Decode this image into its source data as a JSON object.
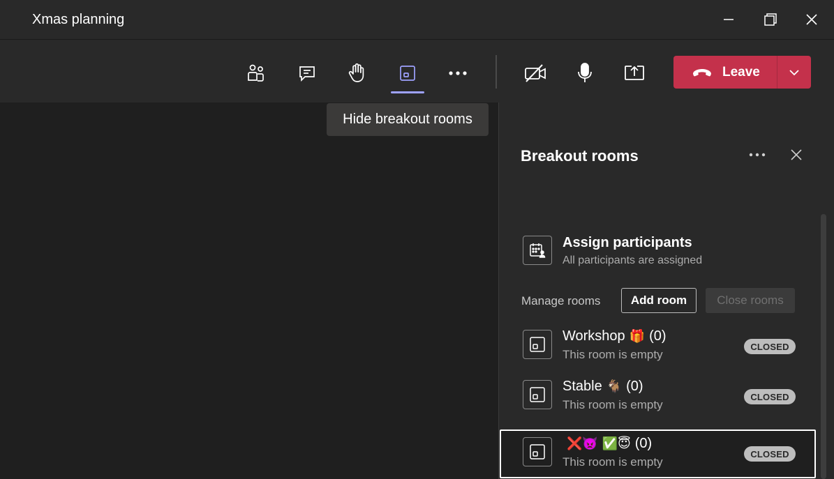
{
  "window": {
    "title": "Xmas planning",
    "controls": [
      "minimize",
      "maximize",
      "close"
    ]
  },
  "toolbar": {
    "buttons": [
      {
        "icon": "people-icon",
        "label": "Participants"
      },
      {
        "icon": "chat-icon",
        "label": "Chat"
      },
      {
        "icon": "raise-hand-icon",
        "label": "Raise hand"
      },
      {
        "icon": "breakout-rooms-icon",
        "label": "Breakout rooms",
        "active": true
      },
      {
        "icon": "more-icon",
        "label": "More actions"
      },
      {
        "icon": "camera-off-icon",
        "label": "Camera off"
      },
      {
        "icon": "microphone-icon",
        "label": "Mic"
      },
      {
        "icon": "share-icon",
        "label": "Share"
      }
    ],
    "leave_label": "Leave",
    "leave_color": "#c4314b",
    "active_indicator_color": "#9ea2ff"
  },
  "tooltip": {
    "text": "Hide breakout rooms"
  },
  "panel": {
    "title": "Breakout rooms",
    "assign": {
      "title": "Assign participants",
      "subtitle": "All participants are assigned"
    },
    "manage_label": "Manage rooms",
    "add_room_label": "Add room",
    "close_rooms_label": "Close rooms",
    "rooms": [
      {
        "name": "Workshop",
        "emoji": "🎁",
        "count": "(0)",
        "status": "This room is empty",
        "badge": "CLOSED"
      },
      {
        "name": "Stable",
        "emoji": "🐐",
        "count": "(0)",
        "status": "This room is empty",
        "badge": "CLOSED"
      },
      {
        "name": "",
        "emoji": "❌👿 ✅😇",
        "count": "(0)",
        "status": "This room is empty",
        "badge": "CLOSED"
      }
    ]
  }
}
